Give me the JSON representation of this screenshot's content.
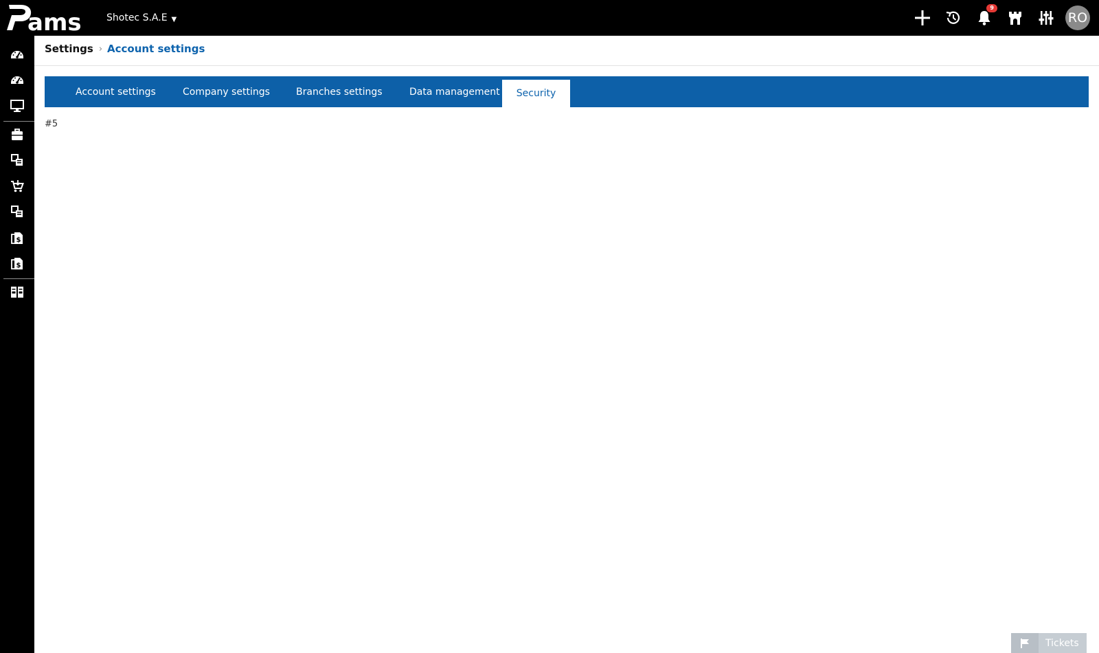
{
  "app": {
    "logo_text": "Pams",
    "company_name": "Shotec S.A.E"
  },
  "header": {
    "notifications_count": "9",
    "user_initials": "RO"
  },
  "sidebar": {
    "items": [
      {
        "icon": "dashboard-icon"
      },
      {
        "icon": "dashboard-icon"
      },
      {
        "icon": "monitor-icon"
      },
      {
        "icon": "briefcase-icon"
      },
      {
        "icon": "products-icon"
      },
      {
        "icon": "cart-icon"
      },
      {
        "icon": "products-icon"
      },
      {
        "icon": "invoice-dollar-icon"
      },
      {
        "icon": "invoice-dollar-icon"
      },
      {
        "icon": "columns-icon"
      }
    ]
  },
  "breadcrumb": {
    "root": "Settings",
    "current": "Account settings"
  },
  "tabs": [
    {
      "label": "Account settings",
      "active": false
    },
    {
      "label": "Company settings",
      "active": false
    },
    {
      "label": "Branches settings",
      "active": false
    },
    {
      "label": "Data management",
      "active": false
    },
    {
      "label": "Security",
      "active": true
    }
  ],
  "content": {
    "text": "#5"
  },
  "tickets": {
    "label": "Tickets"
  },
  "colors": {
    "tab_bar": "#0d60a8",
    "accent": "#0d63ad",
    "badge": "#e53935",
    "topbar": "#000000"
  }
}
